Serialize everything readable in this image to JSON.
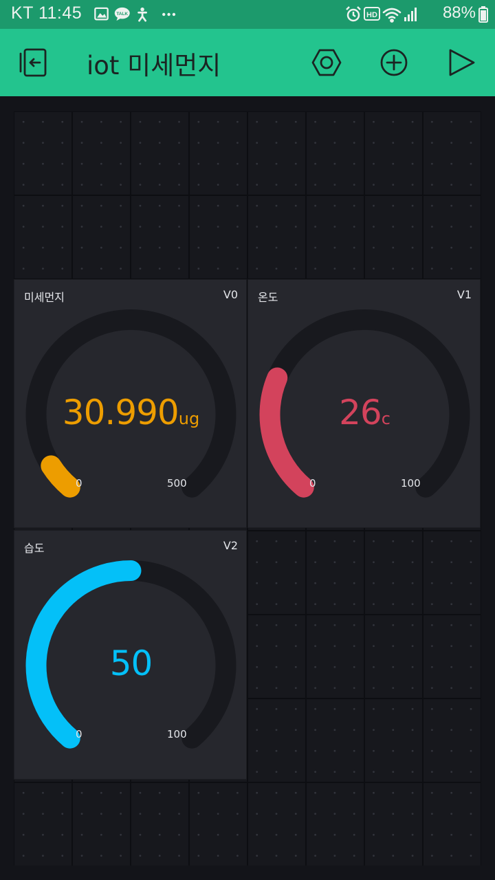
{
  "status_bar": {
    "carrier_time": "KT 11:45",
    "battery": "88%"
  },
  "toolbar": {
    "title": "iot 미세먼지",
    "icons": [
      "exit-icon",
      "settings-hexagon-icon",
      "add-icon",
      "play-icon"
    ]
  },
  "colors": {
    "accent": "#23c48e",
    "dust": "#ed9d00",
    "temp": "#d3435c",
    "humidity": "#04c0f8",
    "track": "#18191e"
  },
  "widgets": [
    {
      "label": "미세먼지",
      "pin": "V0",
      "value": "30.990",
      "unit": "ug",
      "min": "0",
      "max": "500",
      "value_num": 30.99,
      "min_num": 0,
      "max_num": 500
    },
    {
      "label": "온도",
      "pin": "V1",
      "value": "26",
      "unit": "c",
      "min": "0",
      "max": "100",
      "value_num": 26,
      "min_num": 0,
      "max_num": 100
    },
    {
      "label": "습도",
      "pin": "V2",
      "value": "50",
      "unit": "",
      "min": "0",
      "max": "100",
      "value_num": 50,
      "min_num": 0,
      "max_num": 100
    }
  ]
}
